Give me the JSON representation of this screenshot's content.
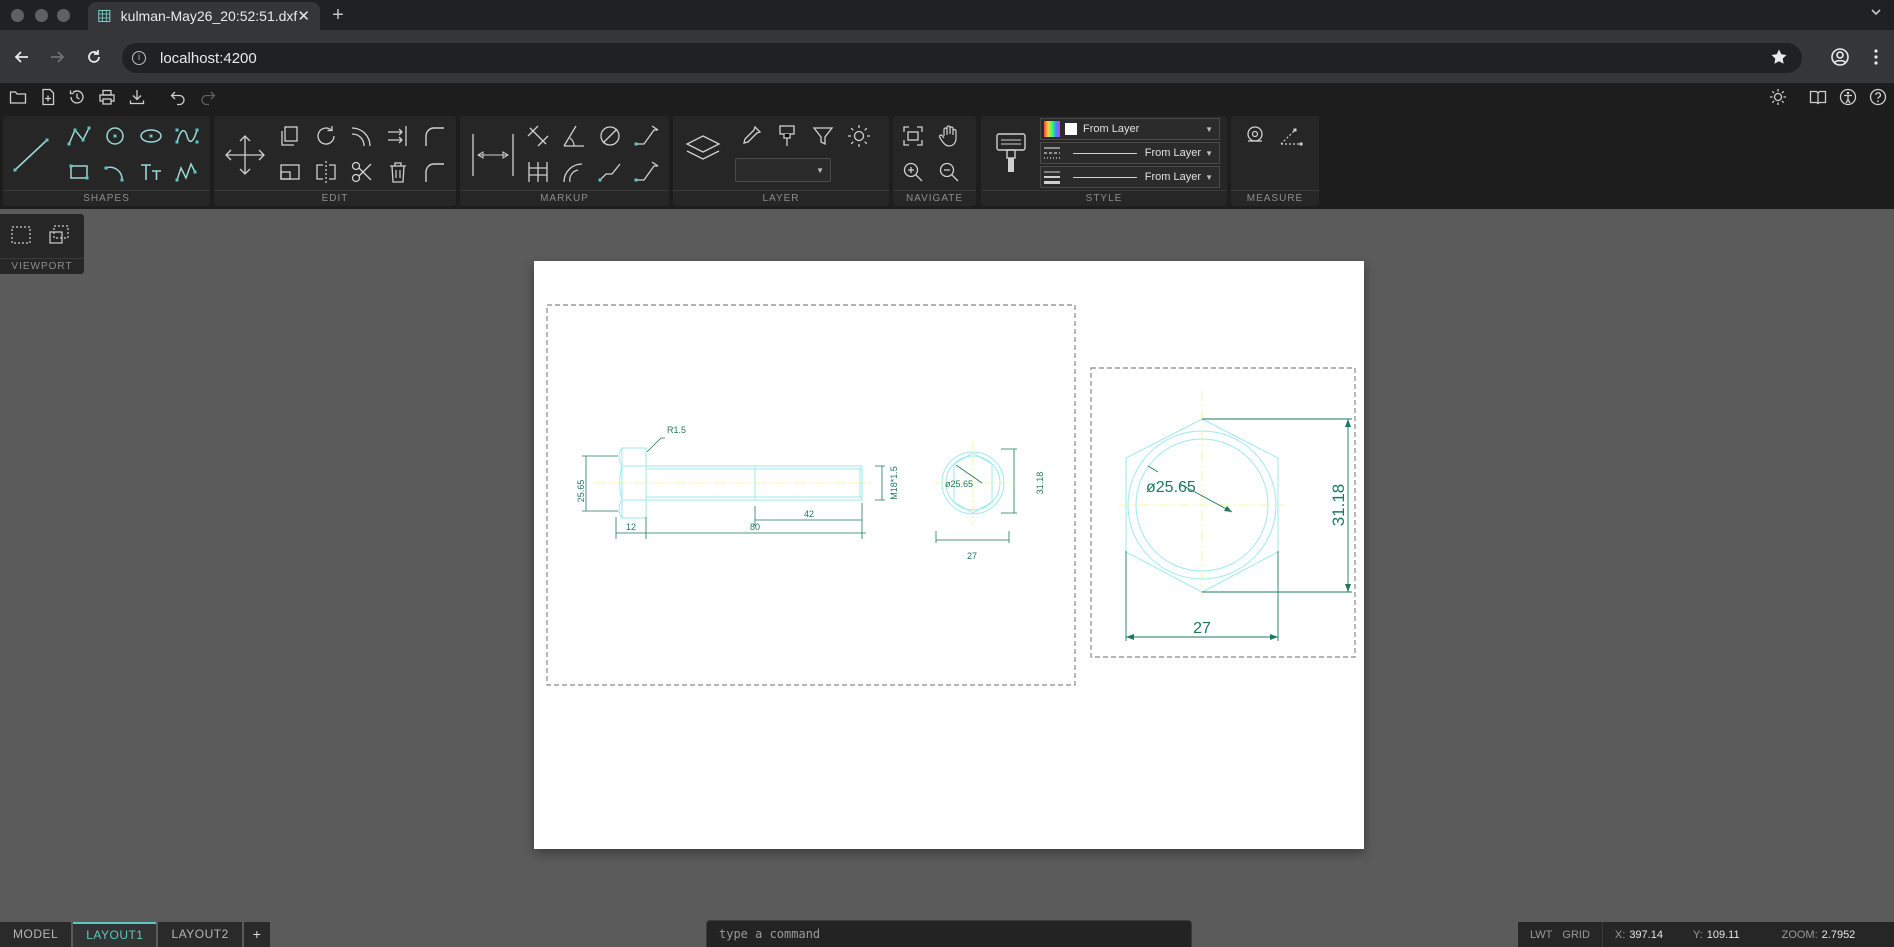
{
  "browser": {
    "tab_title": "kulman-May26_20:52:51.dxf",
    "tab_close": "✕",
    "new_tab": "+",
    "url": "localhost:4200"
  },
  "ribbon": {
    "groups": [
      "SHAPES",
      "EDIT",
      "MARKUP",
      "LAYER",
      "NAVIGATE",
      "STYLE",
      "MEASURE"
    ],
    "style": {
      "color_value": "From Layer",
      "linetype_value": "From Layer",
      "lineweight_value": "From Layer"
    },
    "layer_select_value": ""
  },
  "viewport": {
    "label": "VIEWPORT"
  },
  "drawing": {
    "color_geometry": "#9ee9ee",
    "color_centerline": "#f2f28a",
    "color_dimension": "#1d7a5e",
    "dims_small": {
      "r": "R1.5",
      "head_height": "25.65",
      "head_len": "12",
      "shank_len": "80",
      "thread_len": "42",
      "thread": "M18*1.5",
      "dia": "ø25.65",
      "flats": "31.18",
      "across": "27"
    },
    "dims_large": {
      "dia": "ø25.65",
      "flats": "31.18",
      "across": "27"
    }
  },
  "layout_tabs": [
    {
      "label": "MODEL",
      "active": false
    },
    {
      "label": "LAYOUT1",
      "active": true
    },
    {
      "label": "LAYOUT2",
      "active": false
    }
  ],
  "add_tab": "+",
  "command": {
    "placeholder": "type a command"
  },
  "status": {
    "lwt": "LWT",
    "grid": "GRID",
    "x_label": "X:",
    "x_value": "397.14",
    "y_label": "Y:",
    "y_value": "109.11",
    "zoom_label": "ZOOM:",
    "zoom_value": "2.7952"
  }
}
